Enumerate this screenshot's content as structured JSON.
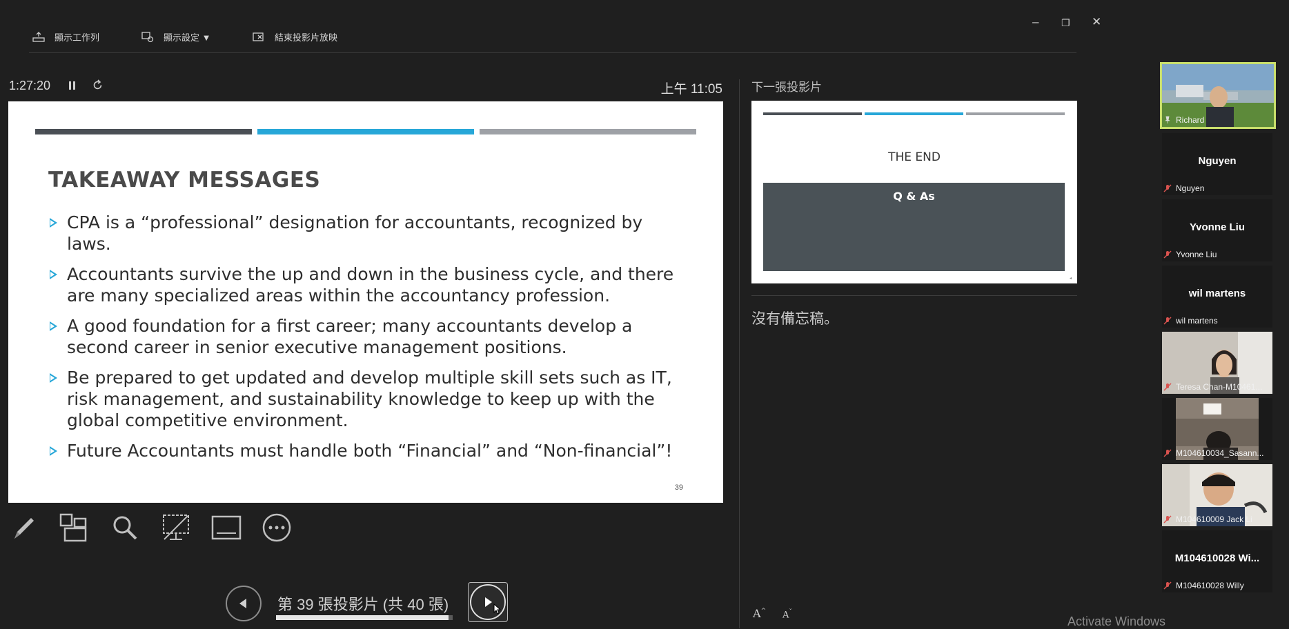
{
  "toolbar": {
    "show_taskbar": "顯示工作列",
    "display_settings": "顯示設定 ▼",
    "end_slideshow": "結束投影片放映"
  },
  "window_controls": {
    "minimize": "–",
    "restore": "❐",
    "close": "✕"
  },
  "timer": "1:27:20",
  "clock": "上午 11:05",
  "slide": {
    "title": "TAKEAWAY MESSAGES",
    "bullets": [
      "CPA is a “professional” designation for accountants, recognized by laws.",
      "Accountants survive the up and down in the business cycle, and there are many specialized areas within the accountancy profession.",
      "A good foundation for a first career; many accountants develop a second career in senior executive management positions.",
      "Be prepared to get updated and develop multiple skill sets such as IT, risk management, and sustainability knowledge to keep up with the global competitive environment.",
      "Future Accountants must handle both “Financial” and “Non-financial”!"
    ],
    "number": "39",
    "bar_colors": [
      "#4a4f55",
      "#27a7d8",
      "#9ea1a6"
    ]
  },
  "nav": {
    "label": "第 39 張投影片 (共 40 張)",
    "current": 39,
    "total": 40
  },
  "next_slide": {
    "header": "下一張投影片",
    "title": "THE END",
    "box_text": "Q & As"
  },
  "notes": "沒有備忘稿。",
  "font_buttons": {
    "increase": "A",
    "decrease": "A"
  },
  "watermark": "Activate Windows",
  "participants": [
    {
      "display": "",
      "tag": "Richard",
      "video": true,
      "active": true
    },
    {
      "display": "Nguyen",
      "tag": "Nguyen",
      "video": false
    },
    {
      "display": "Yvonne Liu",
      "tag": "Yvonne Liu",
      "video": false
    },
    {
      "display": "wil martens",
      "tag": "wil martens",
      "video": false
    },
    {
      "display": "",
      "tag": "Teresa Chan-M10461...",
      "video": true
    },
    {
      "display": "",
      "tag": "M104610034_Sasann...",
      "video": true
    },
    {
      "display": "",
      "tag": "M104610009 Jack Li",
      "video": true
    },
    {
      "display": "M104610028 Wi...",
      "tag": "M104610028 Willy",
      "video": false
    }
  ],
  "colors": {
    "accent": "#27a7d8",
    "active_speaker": "#c9df6c",
    "muted_mic": "#d9534f"
  }
}
